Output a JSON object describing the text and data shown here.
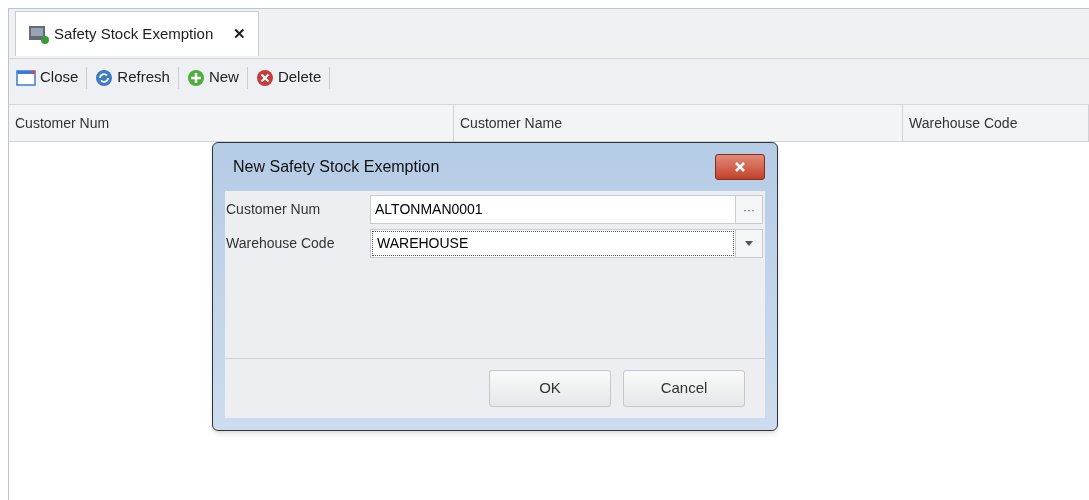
{
  "tab": {
    "title": "Safety Stock Exemption",
    "close": "✕",
    "selected": true
  },
  "toolbar": [
    {
      "kind": "close",
      "label": "Close"
    },
    {
      "kind": "refresh",
      "label": "Refresh"
    },
    {
      "kind": "new",
      "label": "New"
    },
    {
      "kind": "delete",
      "label": "Delete"
    }
  ],
  "table": {
    "columns": [
      "Customer Num",
      "Customer Name",
      "Warehouse Code"
    ]
  },
  "dialog": {
    "title": "New Safety Stock Exemption",
    "fields": [
      {
        "kind": "lookup",
        "label": "Customer Num",
        "value": "ALTONMAN0001",
        "button": "···"
      },
      {
        "kind": "dropdown",
        "label": "Warehouse Code",
        "value": "WAREHOUSE"
      }
    ],
    "buttons": [
      "OK",
      "Cancel"
    ]
  }
}
